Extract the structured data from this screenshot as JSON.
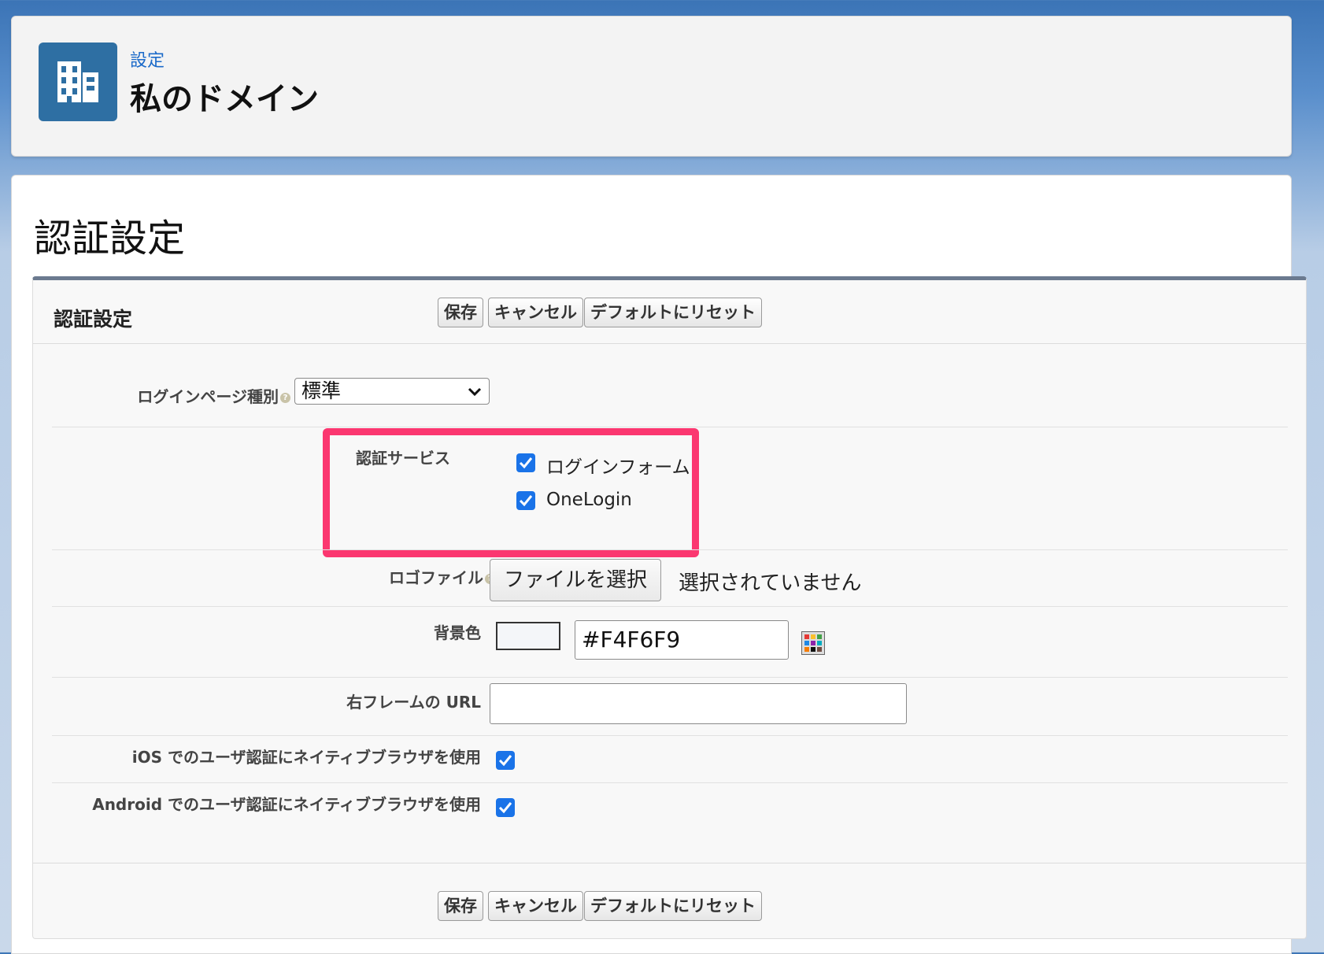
{
  "header": {
    "breadcrumb": "設定",
    "title": "私のドメイン",
    "icon": "building-icon",
    "icon_color": "#2e6fa3"
  },
  "section_title": "認証設定",
  "panel": {
    "title": "認証設定",
    "buttons": {
      "save": "保存",
      "cancel": "キャンセル",
      "reset": "デフォルトにリセット"
    }
  },
  "form": {
    "login_page_type": {
      "label": "ログインページ種別",
      "value": "標準"
    },
    "auth_services": {
      "label": "認証サービス",
      "options": [
        {
          "label": "ログインフォーム",
          "checked": true
        },
        {
          "label": "OneLogin",
          "checked": true
        }
      ],
      "highlight_color": "#fb3770"
    },
    "logo_file": {
      "label": "ロゴファイル",
      "button": "ファイルを選択",
      "status": "選択されていません"
    },
    "background_color": {
      "label": "背景色",
      "value": "#F4F6F9"
    },
    "right_frame_url": {
      "label": "右フレームの URL",
      "value": ""
    },
    "ios_native_browser": {
      "label": "iOS でのユーザ認証にネイティブブラウザを使用",
      "checked": true
    },
    "android_native_browser": {
      "label": "Android でのユーザ認証にネイティブブラウザを使用",
      "checked": true
    }
  }
}
